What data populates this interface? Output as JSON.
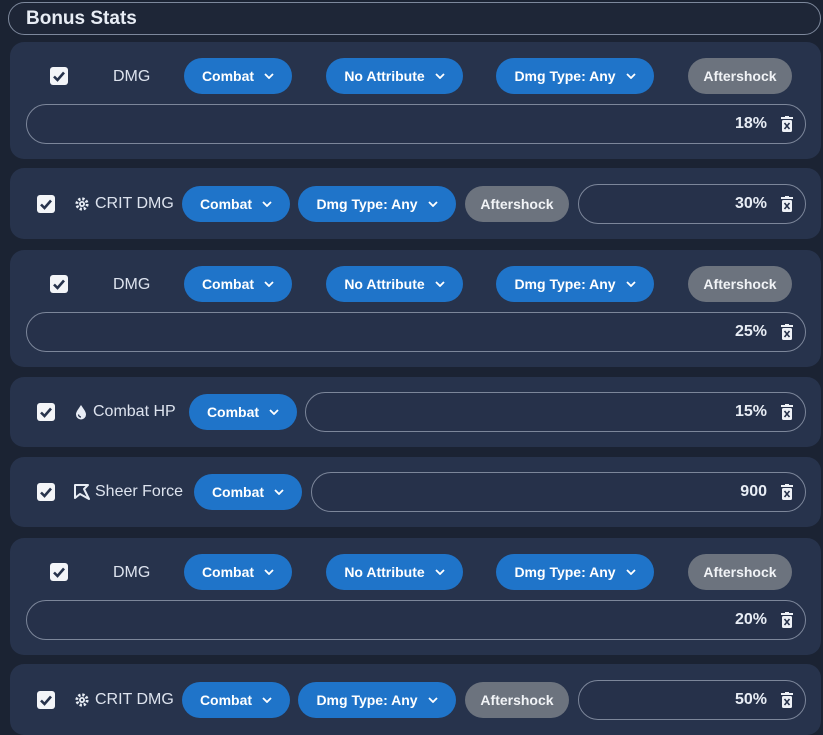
{
  "section": {
    "title": "Bonus Stats"
  },
  "rows": [
    {
      "label": "DMG",
      "stat_icon": "",
      "dropdowns": [
        "Combat",
        "No Attribute",
        "Dmg Type: Any"
      ],
      "tag": "Aftershock",
      "value": "18%",
      "checked": true
    },
    {
      "label": "CRIT DMG",
      "stat_icon": "crit-gear-icon",
      "dropdowns": [
        "Combat",
        "Dmg Type: Any"
      ],
      "tag": "Aftershock",
      "value": "30%",
      "checked": true
    },
    {
      "label": "DMG",
      "stat_icon": "",
      "dropdowns": [
        "Combat",
        "No Attribute",
        "Dmg Type: Any"
      ],
      "tag": "Aftershock",
      "value": "25%",
      "checked": true
    },
    {
      "label": "Combat HP",
      "stat_icon": "drop-icon",
      "dropdowns": [
        "Combat"
      ],
      "tag": "",
      "value": "15%",
      "checked": true
    },
    {
      "label": "Sheer Force",
      "stat_icon": "sheer-force-icon",
      "dropdowns": [
        "Combat"
      ],
      "tag": "",
      "value": "900",
      "checked": true
    },
    {
      "label": "DMG",
      "stat_icon": "",
      "dropdowns": [
        "Combat",
        "No Attribute",
        "Dmg Type: Any"
      ],
      "tag": "Aftershock",
      "value": "20%",
      "checked": true
    },
    {
      "label": "CRIT DMG",
      "stat_icon": "crit-gear-icon",
      "dropdowns": [
        "Combat",
        "Dmg Type: Any"
      ],
      "tag": "Aftershock",
      "value": "50%",
      "checked": true
    }
  ],
  "colors": {
    "background": "#1b2333",
    "card": "#27334c",
    "pill": "#1f74c9",
    "tag": "#6c737e"
  }
}
